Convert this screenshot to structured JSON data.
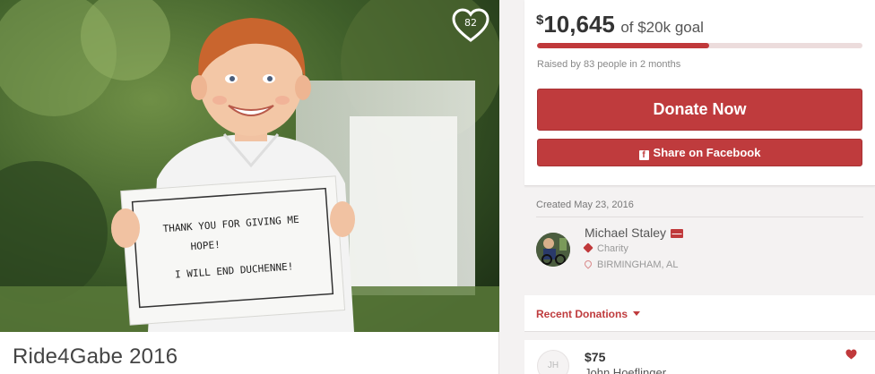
{
  "campaign": {
    "title": "Ride4Gabe 2016",
    "heart_count": "82",
    "photo_sign_lines": [
      "THANK YOU FOR GIVING ME",
      "HOPE!",
      "I WILL END DUCHENNE!"
    ]
  },
  "goal": {
    "currency": "$",
    "amount": "10,645",
    "goal_text": "of $20k goal",
    "progress_fraction": 0.53,
    "raised_by": "Raised by 83 people in 2 months"
  },
  "actions": {
    "donate_label": "Donate Now",
    "share_label": "Share on Facebook"
  },
  "organizer": {
    "created": "Created May 23, 2016",
    "name": "Michael Staley",
    "category": "Charity",
    "location": "BIRMINGHAM, AL"
  },
  "donations": {
    "header": "Recent Donations",
    "items": [
      {
        "initials": "JH",
        "amount": "$75",
        "name": "John Hoeflinger"
      }
    ]
  },
  "colors": {
    "accent": "#bf3b3d",
    "progress_track": "#ecdcdc",
    "page_bg": "#f4f2f2"
  },
  "icons": {
    "heart": "heart-icon",
    "facebook": "facebook-icon",
    "mail": "mail-icon",
    "tag": "tag-icon",
    "location": "location-pin-icon",
    "caret": "chevron-down-icon"
  }
}
